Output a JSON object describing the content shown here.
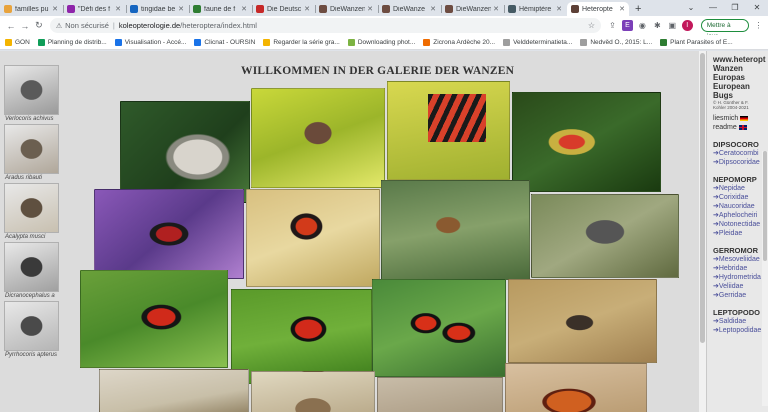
{
  "tabs": [
    {
      "label": "familles pu",
      "color": "#e8a33d"
    },
    {
      "label": "\"Défi des f",
      "color": "#8e24aa"
    },
    {
      "label": "tingidae be",
      "color": "#1565c0"
    },
    {
      "label": "faune de f",
      "color": "#2e7d32"
    },
    {
      "label": "Die Deutsc",
      "color": "#c62828"
    },
    {
      "label": "DieWanzen",
      "color": "#6d4c41"
    },
    {
      "label": "DieWanze",
      "color": "#6d4c41"
    },
    {
      "label": "DieWanzen",
      "color": "#6d4c41"
    },
    {
      "label": "Hémiptère",
      "color": "#455a64"
    },
    {
      "label": "Heteropte",
      "color": "#5d4037",
      "active": true
    }
  ],
  "toolbar": {
    "insecure_label": "Non sécurisé",
    "url_host": "koleopterologie.de",
    "url_path": "/heteroptera/index.html",
    "update_label": "Mettre à jour",
    "avatar_letter": "I"
  },
  "bookmarks": [
    {
      "label": "GON",
      "color": "#f4b400"
    },
    {
      "label": "Planning de distrib...",
      "color": "#0f9d58"
    },
    {
      "label": "Visualisation - Accé...",
      "color": "#1a73e8"
    },
    {
      "label": "Clicnat - OURSIN",
      "color": "#1a73e8"
    },
    {
      "label": "Regarder la série gra...",
      "color": "#f4b400"
    },
    {
      "label": "Downloading phot...",
      "color": "#7cb342"
    },
    {
      "label": "Zicrona Ardèche 20...",
      "color": "#ef6c00"
    },
    {
      "label": "Velddeterminatieta...",
      "color": "#9e9e9e"
    },
    {
      "label": "Nedvěd O., 2015: L...",
      "color": "#9e9e9e"
    },
    {
      "label": "Plant Parasites of E...",
      "color": "#2e7d32"
    }
  ],
  "sidebar_thumbs": [
    {
      "caption": "Verlocoris achivus",
      "colors": [
        "#9a9a9a",
        "#5a5a5a"
      ]
    },
    {
      "caption": "Aradus ribauti",
      "colors": [
        "#b0a79a",
        "#6b5f50"
      ]
    },
    {
      "caption": "Acalypta musci",
      "colors": [
        "#c8c0b0",
        "#5f5040"
      ]
    },
    {
      "caption": "Dicranocephalus a",
      "colors": [
        "#a0a0a0",
        "#3a3a3a"
      ]
    },
    {
      "caption": "Pyrrhocoris apterus",
      "colors": [
        "#b5b5b5",
        "#4a4a4a"
      ]
    }
  ],
  "gallery": {
    "title": "WILLKOMMEN IN DER GALERIE DER WANZEN"
  },
  "right_panel": {
    "title_lines": [
      "www.heteropt",
      "Wanzen",
      "Europas",
      "European",
      "Bugs"
    ],
    "credit_lines": [
      "© H. Günther & F.",
      "Kohler 2004-2021"
    ],
    "links": [
      {
        "label": "liesmich",
        "flag": "de"
      },
      {
        "label": "readme",
        "flag": "uk"
      }
    ],
    "groups": [
      {
        "heading": "DIPSOCORO",
        "items": [
          "Ceratocombi",
          "Dipsocoridae"
        ]
      },
      {
        "heading": "NEPOMORP",
        "items": [
          "Nepidae",
          "Corixidae",
          "Naucoridae",
          "Aphelocheiri",
          "Notonectidae",
          "Pleidae"
        ]
      },
      {
        "heading": "GERROMOR",
        "items": [
          "Mesoveliidae",
          "Hebridae",
          "Hydrometrida",
          "Veliidae",
          "Gerridae"
        ]
      },
      {
        "heading": "LEPTOPODO",
        "items": [
          "Saldidae",
          "Leptopodidae"
        ]
      }
    ]
  }
}
